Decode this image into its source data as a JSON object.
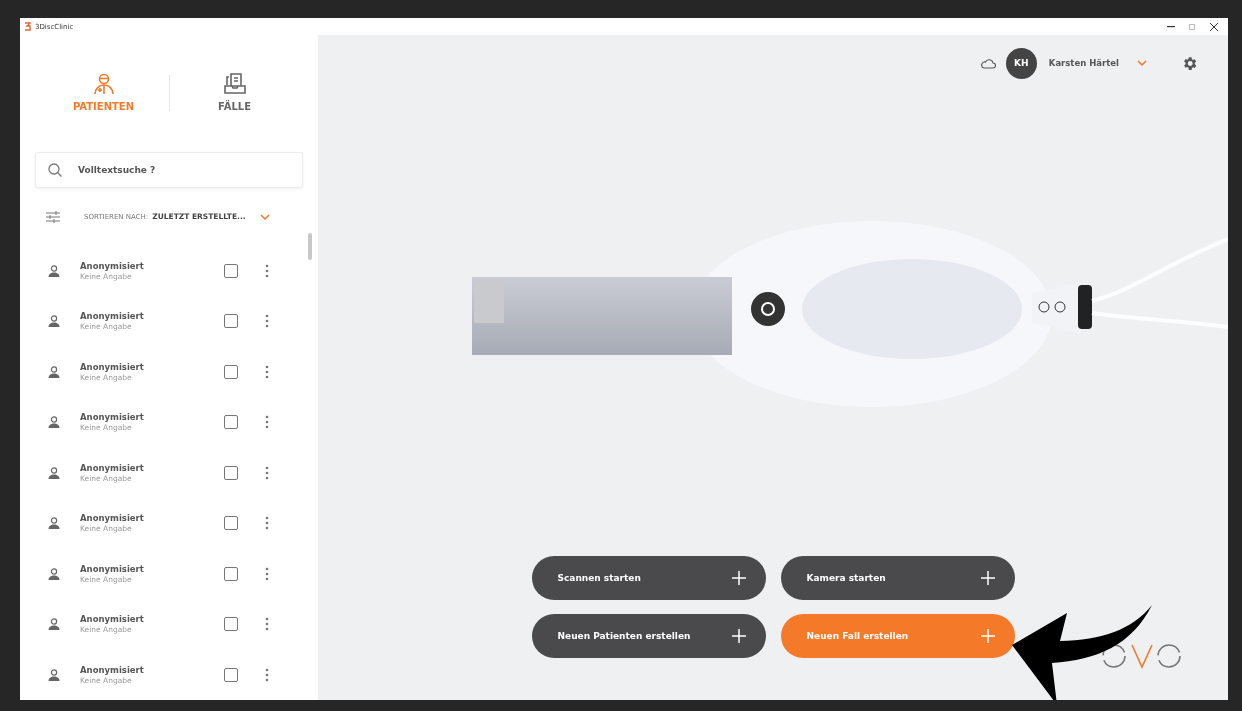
{
  "window": {
    "title": "3DiscClinic"
  },
  "nav_tabs": [
    {
      "label": "PATIENTEN",
      "kind": "patients",
      "selected": true
    },
    {
      "label": "FÄLLE",
      "kind": "cases",
      "selected": false
    }
  ],
  "search": {
    "placeholder": "Volltextsuche ?"
  },
  "sort": {
    "label": "SORTIEREN NACH:",
    "value": "ZULETZT ERSTELLTE..."
  },
  "patients": [
    {
      "name": "Anonymisiert",
      "detail": "Keine Angabe",
      "checked": false
    },
    {
      "name": "Anonymisiert",
      "detail": "Keine Angabe",
      "checked": false
    },
    {
      "name": "Anonymisiert",
      "detail": "Keine Angabe",
      "checked": false
    },
    {
      "name": "Anonymisiert",
      "detail": "Keine Angabe",
      "checked": false
    },
    {
      "name": "Anonymisiert",
      "detail": "Keine Angabe",
      "checked": false
    },
    {
      "name": "Anonymisiert",
      "detail": "Keine Angabe",
      "checked": false
    },
    {
      "name": "Anonymisiert",
      "detail": "Keine Angabe",
      "checked": false
    },
    {
      "name": "Anonymisiert",
      "detail": "Keine Angabe",
      "checked": false
    },
    {
      "name": "Anonymisiert",
      "detail": "Keine Angabe",
      "checked": false
    }
  ],
  "user": {
    "initials": "KH",
    "name": "Karsten Härtel"
  },
  "actions": [
    {
      "label": "Scannen starten",
      "kind": "dark"
    },
    {
      "label": "Kamera starten",
      "kind": "dark"
    },
    {
      "label": "Neuen Patienten erstellen",
      "kind": "dark"
    },
    {
      "label": "Neuen Fall erstellen",
      "kind": "accent"
    }
  ]
}
